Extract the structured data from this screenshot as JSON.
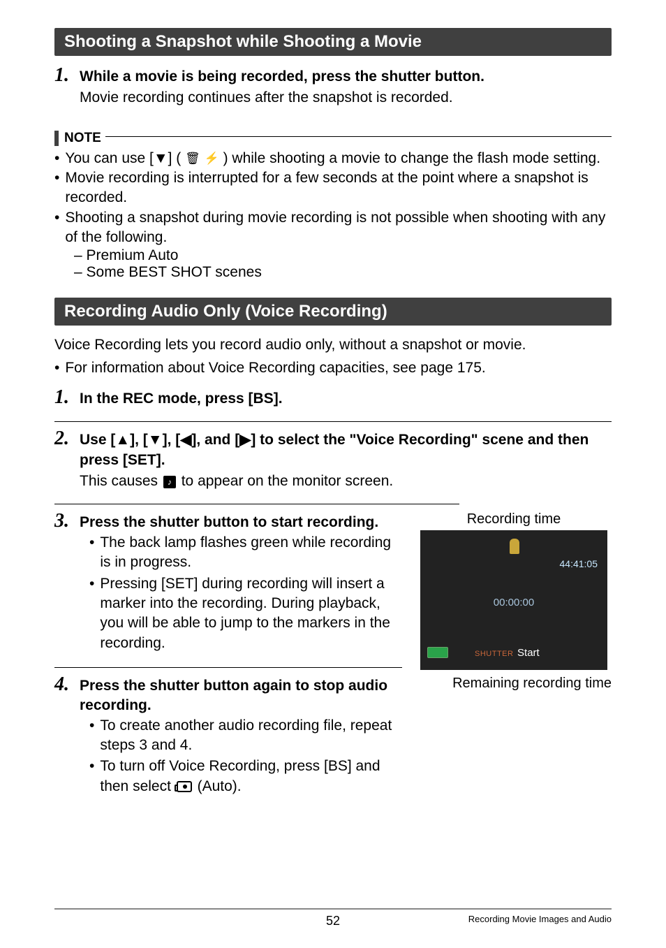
{
  "section1": {
    "heading": "Shooting a Snapshot while Shooting a Movie",
    "step1_title": "While a movie is being recorded, press the shutter button.",
    "step1_sub": "Movie recording continues after the snapshot is recorded."
  },
  "note": {
    "label": "NOTE",
    "b1a": "You can use [▼] ( ",
    "b1b": " ) while shooting a movie to change the flash mode setting.",
    "b2": "Movie recording is interrupted for a few seconds at the point where a snapshot is recorded.",
    "b3": "Shooting a snapshot during movie recording is not possible when shooting with any of the following.",
    "d1": "Premium Auto",
    "d2": "Some BEST SHOT scenes"
  },
  "section2": {
    "heading": "Recording Audio Only (Voice Recording)",
    "intro1": "Voice Recording lets you record audio only, without a snapshot or movie.",
    "intro2": "For information about Voice Recording capacities, see page 175.",
    "step1_title": "In the REC mode, press [BS].",
    "step2_title": "Use [▲], [▼], [◀], and [▶] to select the \"Voice Recording\" scene and then press [SET].",
    "step2_sub_a": "This causes ",
    "step2_sub_b": " to appear on the monitor screen.",
    "step3_title": "Press the shutter button to start recording.",
    "step3_b1": "The back lamp flashes green while recording is in progress.",
    "step3_b2": "Pressing [SET] during recording will insert a marker into the recording. During playback, you will be able to jump to the markers in the recording.",
    "step4_title": "Press the shutter button again to stop audio recording.",
    "step4_b1": "To create another audio recording file, repeat steps 3 and 4.",
    "step4_b2a": "To turn off Voice Recording, press [BS] and then select ",
    "step4_b2b": " (Auto)."
  },
  "screen": {
    "caption_top": "Recording time",
    "rec_time": "44:41:05",
    "elapsed": "00:00:00",
    "shutter_label": "SHUTTER",
    "start": "Start",
    "caption_bottom": "Remaining recording time"
  },
  "nums": {
    "n1": "1.",
    "n2": "2.",
    "n3": "3.",
    "n4": "4."
  },
  "glyph": {
    "q": "♪",
    "trash": "🗑",
    "flash": "⚡"
  },
  "footer": {
    "page": "52",
    "title": "Recording Movie Images and Audio"
  }
}
